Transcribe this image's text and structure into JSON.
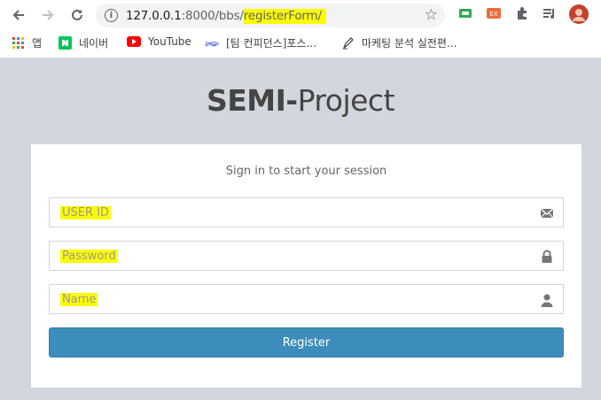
{
  "browser": {
    "url_host": "127.0.0.1",
    "url_port_path": ":8000/bbs/",
    "url_highlight": "registerForm/",
    "bookmarks": [
      {
        "label": "앱",
        "icon": "apps-grid-icon"
      },
      {
        "label": "네이버",
        "icon": "naver-icon"
      },
      {
        "label": "YouTube",
        "icon": "youtube-icon"
      },
      {
        "label": "[팀 컨피던스]포스...",
        "icon": "confluence-icon"
      },
      {
        "label": "마케팅 분석 실전편...",
        "icon": "pen-icon"
      }
    ]
  },
  "page": {
    "logo_bold": "SEMI-",
    "logo_light": "Project",
    "message": "Sign in to start your session",
    "fields": {
      "userid_placeholder": "USER ID",
      "password_placeholder": "Password",
      "name_placeholder": "Name"
    },
    "register_label": "Register"
  },
  "colors": {
    "page_bg": "#d2d6de",
    "primary": "#3c8dbc",
    "highlight": "#fdfd00"
  }
}
